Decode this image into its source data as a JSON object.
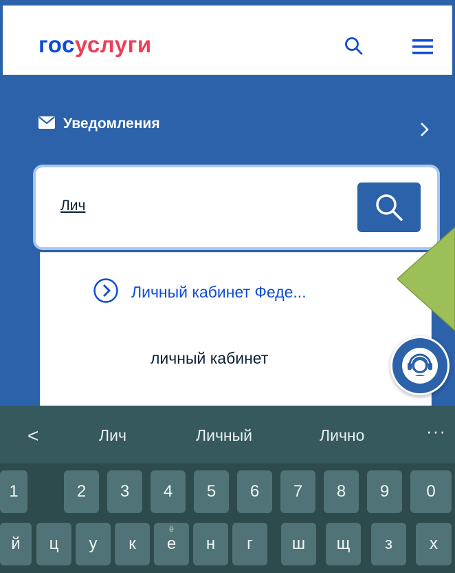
{
  "header": {
    "logo_part1": "гос",
    "logo_part2": "услуги",
    "search_icon": "search-icon",
    "menu_icon": "hamburger-menu-icon",
    "logo_blue": "#0d4cd3",
    "logo_red": "#ee3f58"
  },
  "notifications": {
    "label": "Уведомления",
    "icon": "envelope-icon"
  },
  "search": {
    "value": "Лич",
    "button_icon": "search-icon"
  },
  "suggestions": [
    {
      "label": "Личный кабинет Феде...",
      "icon": "chevron-circle-right-icon"
    },
    {
      "label": "личный кабинет"
    }
  ],
  "keyboard": {
    "back": "<",
    "suggestions": [
      "Лич",
      "Личный",
      "Лично"
    ],
    "more": "···",
    "row1": [
      "1",
      "2",
      "3",
      "4",
      "5",
      "6",
      "7",
      "8",
      "9",
      "0"
    ],
    "row2": [
      "й",
      "ц",
      "у",
      "к",
      "е",
      "н",
      "г",
      "ш",
      "щ",
      "з",
      "х"
    ],
    "row2_sup": "ё"
  },
  "colors": {
    "primary": "#2b62aa",
    "keyboard_bg": "#35595c",
    "key_bg": "#4f7376",
    "hint_triangle": "#9cbf58"
  }
}
